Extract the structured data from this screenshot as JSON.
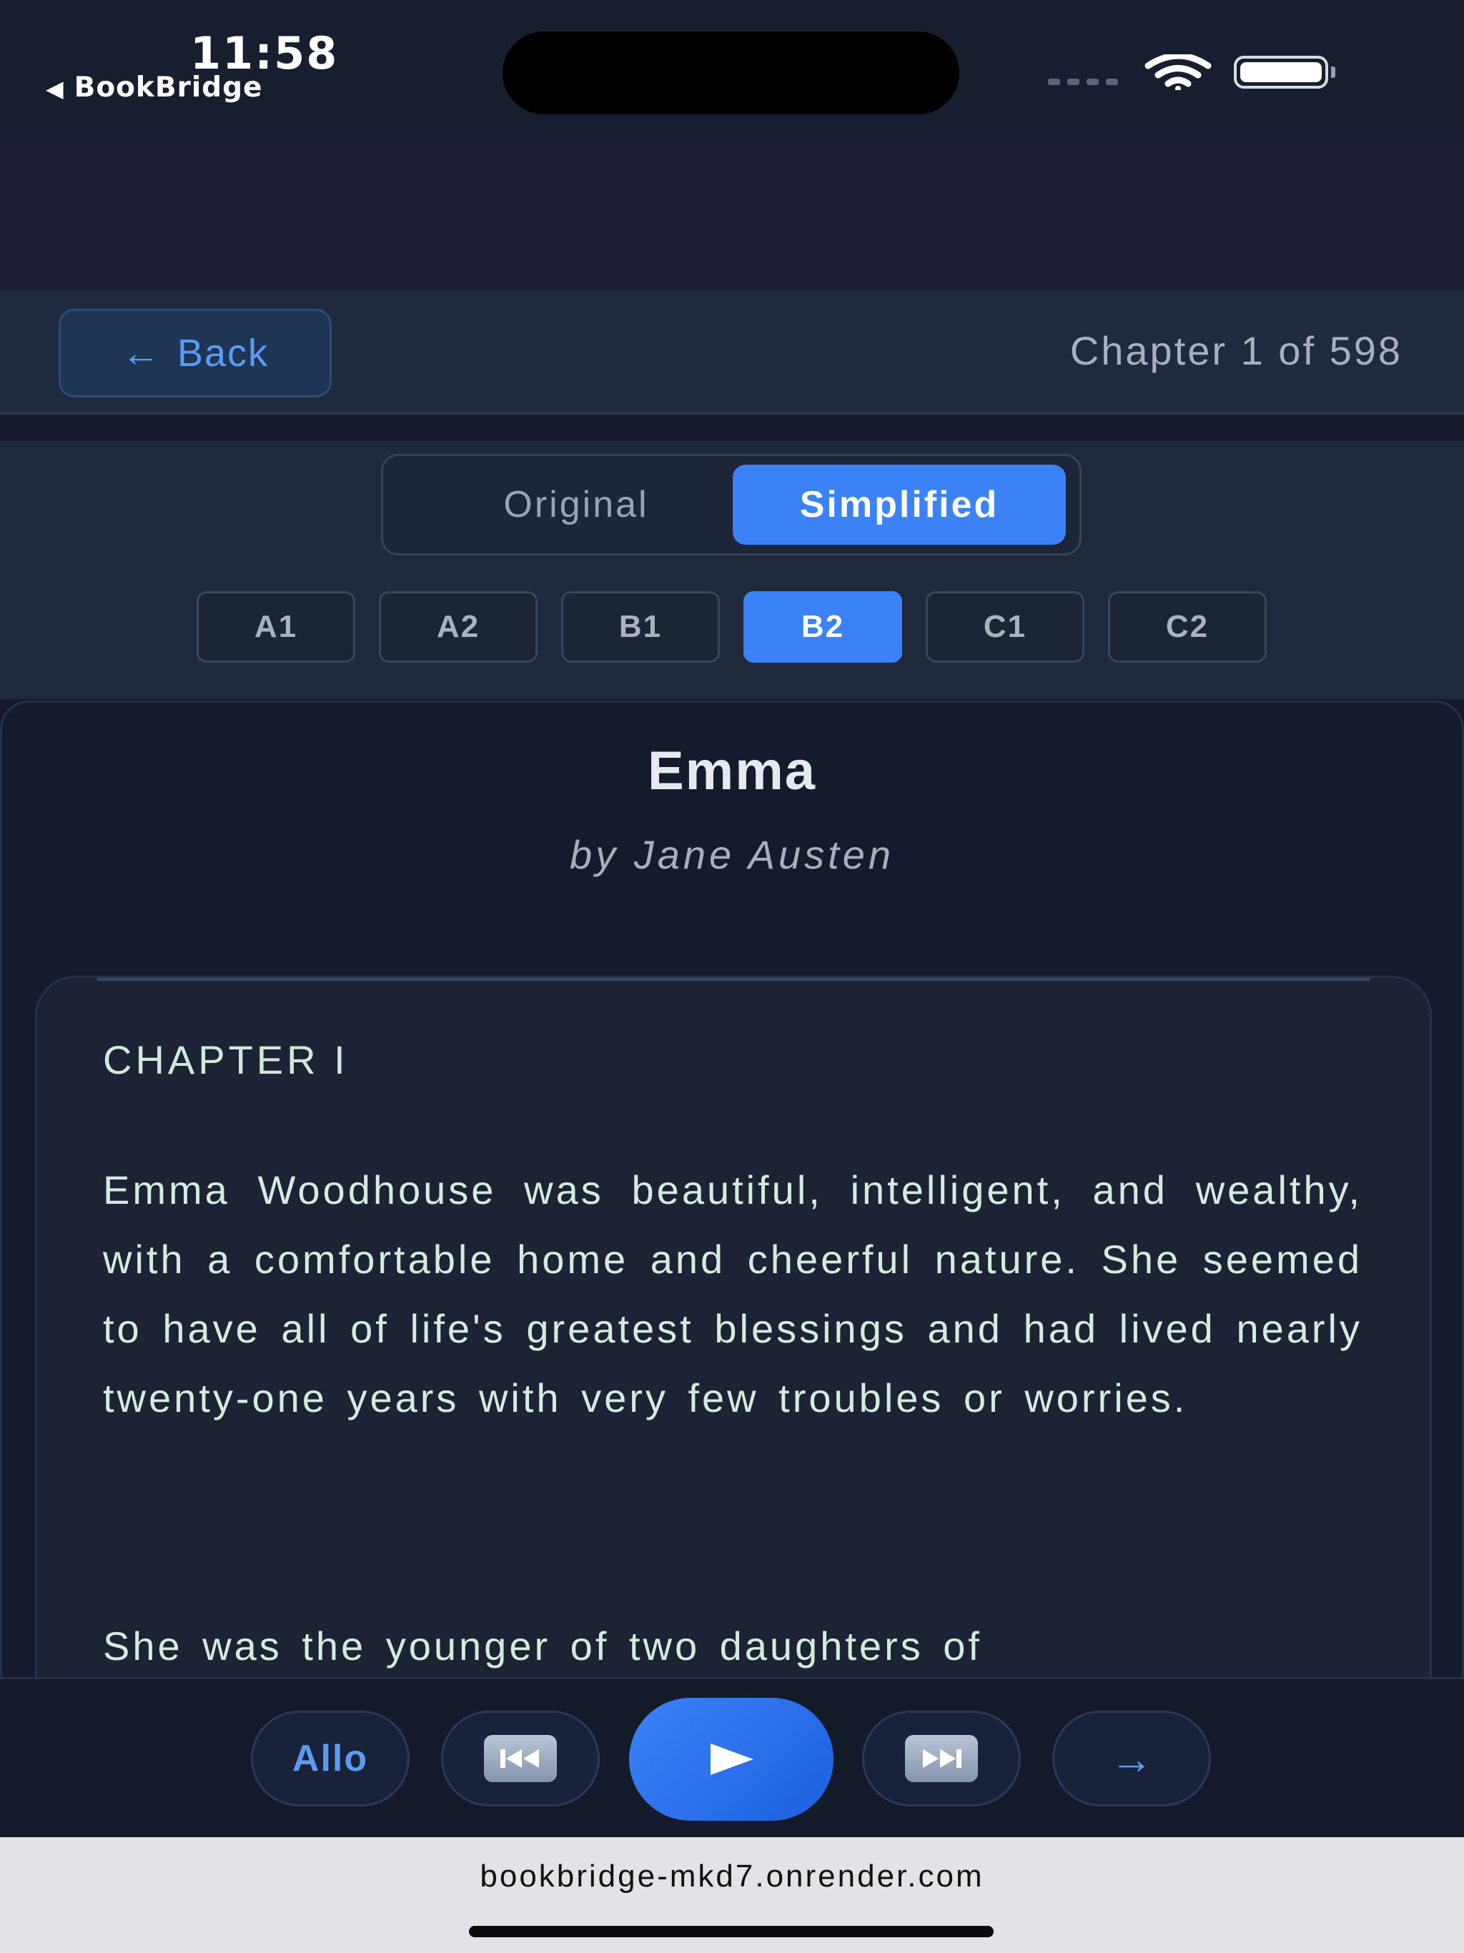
{
  "status_bar": {
    "time": "11:58",
    "back_app_label": "BookBridge",
    "icons": [
      "cellular-signal-icon",
      "wifi-icon",
      "battery-icon"
    ]
  },
  "nav": {
    "back_label": "Back",
    "back_arrow": "←",
    "chapter_indicator": "Chapter 1 of 598"
  },
  "mode_toggle": {
    "options": [
      "Original",
      "Simplified"
    ],
    "selected": "Simplified"
  },
  "levels": {
    "options": [
      "A1",
      "A2",
      "B1",
      "B2",
      "C1",
      "C2"
    ],
    "selected": "B2"
  },
  "book": {
    "title": "Emma",
    "author": "by Jane Austen",
    "chapter_heading": "CHAPTER I",
    "paragraphs": [
      "Emma Woodhouse was beautiful, intelligent, and wealthy, with a comfortable home and cheerful nature. She seemed to have all of life's greatest blessings and had lived nearly twenty-one years with very few troubles or worries.",
      "She was the younger of two daughters of"
    ]
  },
  "audio_controls": {
    "voice_label": "Allo",
    "prev_icon": "skip-back-icon",
    "play_icon": "play-icon",
    "next_icon": "skip-forward-icon",
    "forward_glyph": "→"
  },
  "browser": {
    "url": "bookbridge-mkd7.onrender.com"
  },
  "colors": {
    "accent": "#3b82f6",
    "background": "#141a2b",
    "reading_text": "#d4ecdf"
  }
}
